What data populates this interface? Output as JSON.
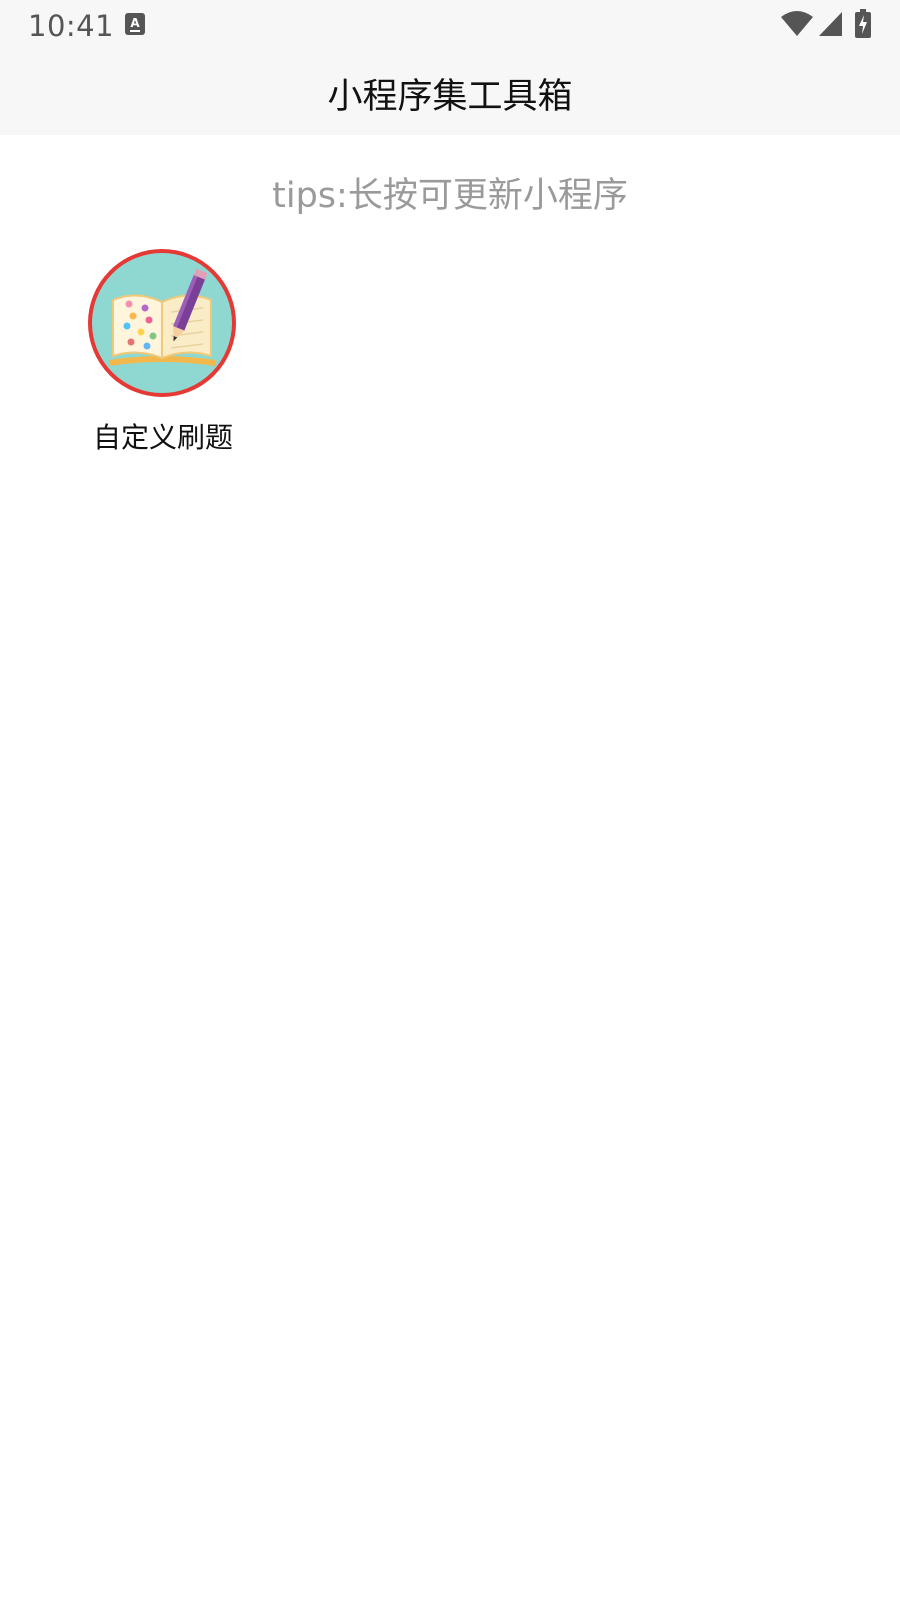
{
  "status_bar": {
    "time": "10:41",
    "notification_icon": "a-notification-icon",
    "wifi_icon": "wifi-icon",
    "signal_icon": "cell-signal-icon",
    "battery_icon": "battery-charging-icon"
  },
  "header": {
    "title": "小程序集工具箱"
  },
  "tip": {
    "text": "tips:长按可更新小程序"
  },
  "apps": [
    {
      "label": "自定义刷题",
      "icon": "open-book-pencil-icon"
    }
  ],
  "colors": {
    "icon_ring": "#e53935",
    "icon_bg": "#8fd8d2",
    "tip_text": "#9a9a9a",
    "header_bg": "#f7f7f7"
  }
}
